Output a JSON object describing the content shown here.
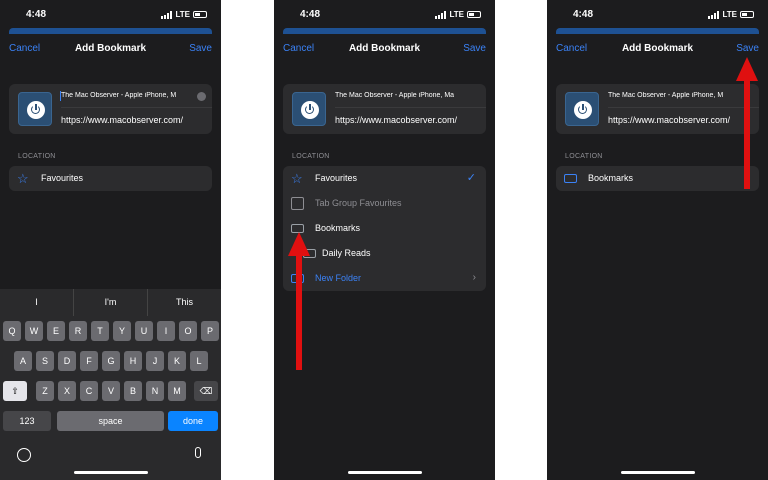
{
  "status": {
    "time": "4:48",
    "network": "LTE"
  },
  "nav": {
    "cancel": "Cancel",
    "title": "Add Bookmark",
    "save": "Save"
  },
  "bookmark": {
    "title_1": "The Mac Observer - Apple iPhone, M",
    "title_2": "The Mac Observer - Apple iPhone, Ma",
    "title_3": "The Mac Observer - Apple iPhone, M",
    "url": "https://www.macobserver.com/"
  },
  "location_label": "LOCATION",
  "screen1": {
    "location": "Favourites"
  },
  "screen2": {
    "items": [
      {
        "label": "Favourites",
        "icon": "star-icon"
      },
      {
        "label": "Tab Group Favourites",
        "icon": "tab-group-icon"
      },
      {
        "label": "Bookmarks",
        "icon": "folder-icon"
      },
      {
        "label": "Daily Reads",
        "icon": "folder-icon"
      },
      {
        "label": "New Folder",
        "icon": "folder-icon"
      }
    ],
    "checkmark": "✓",
    "chevron": "›"
  },
  "screen3": {
    "location": "Bookmarks"
  },
  "keyboard": {
    "suggestions": [
      "I",
      "I'm",
      "This"
    ],
    "row1": [
      "Q",
      "W",
      "E",
      "R",
      "T",
      "Y",
      "U",
      "I",
      "O",
      "P"
    ],
    "row2": [
      "A",
      "S",
      "D",
      "F",
      "G",
      "H",
      "J",
      "K",
      "L"
    ],
    "row3": [
      "Z",
      "X",
      "C",
      "V",
      "B",
      "N",
      "M"
    ],
    "numbers": "123",
    "space": "space",
    "done": "done"
  },
  "colors": {
    "accent": "#3b82f6",
    "arrow": "#e01010",
    "background": "#1c1c1e"
  }
}
